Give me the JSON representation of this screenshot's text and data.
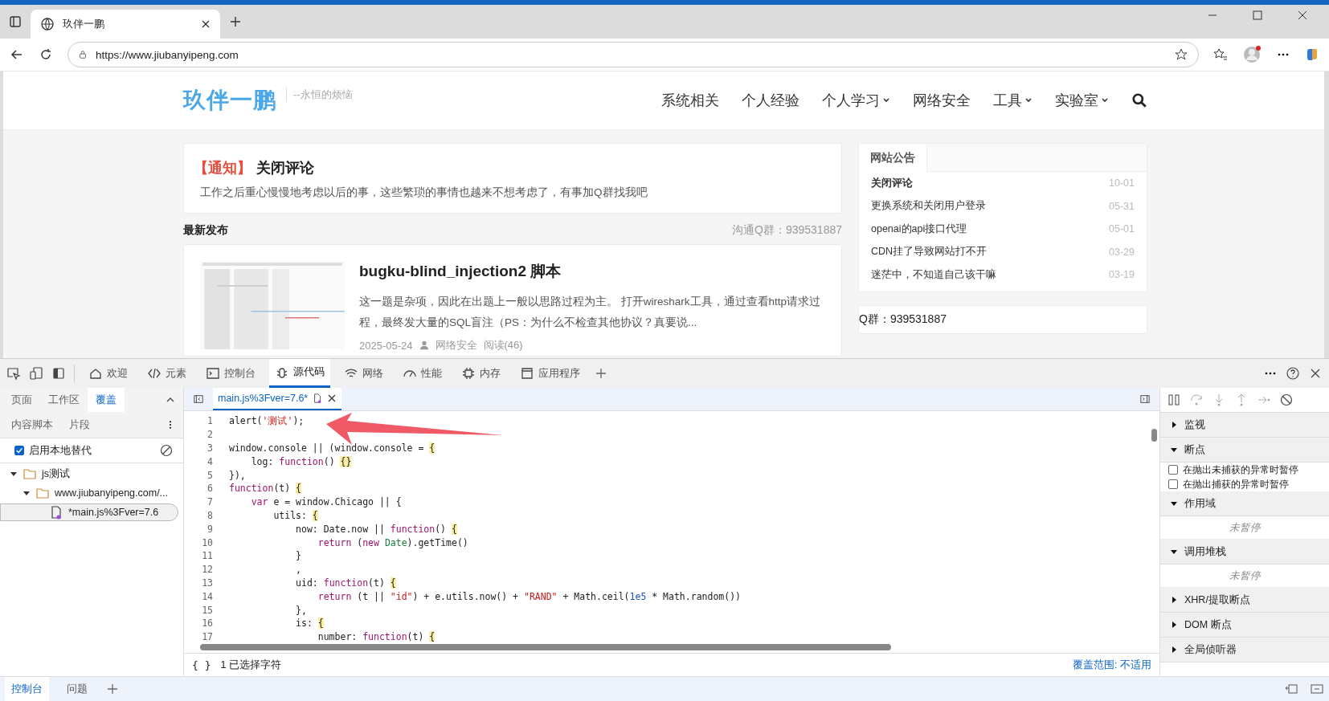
{
  "browser": {
    "tab_title": "玖伴一鹏",
    "url": "https://www.jiubanyipeng.com"
  },
  "site": {
    "logo": "玖伴一鹏",
    "tagline": "--永恒的烦恼",
    "nav": [
      {
        "label": "系统相关",
        "dropdown": false
      },
      {
        "label": "个人经验",
        "dropdown": false
      },
      {
        "label": "个人学习",
        "dropdown": true
      },
      {
        "label": "网络安全",
        "dropdown": false
      },
      {
        "label": "工具",
        "dropdown": true
      },
      {
        "label": "实验室",
        "dropdown": true
      }
    ],
    "notice": {
      "tag": "【通知】",
      "title": "关闭评论",
      "body": "工作之后重心慢慢地考虑以后的事，这些繁琐的事情也越来不想考虑了，有事加Q群找我吧"
    },
    "latest": {
      "heading": "最新发布",
      "group": "沟通Q群：939531887"
    },
    "post": {
      "title": "bugku-blind_injection2 脚本",
      "excerpt": "这一题是杂项，因此在出题上一般以思路过程为主。 打开wireshark工具，通过查看http请求过程，最终发大量的SQL盲注（PS：为什么不检查其他协议？真要说...",
      "date": "2025-05-24",
      "category": "网络安全",
      "reads": "阅读(46)"
    },
    "announcements": {
      "tab": "网站公告",
      "items": [
        {
          "title": "关闭评论",
          "date": "10-01",
          "emphasis": true
        },
        {
          "title": "更换系统和关闭用户登录",
          "date": "05-31",
          "emphasis": false
        },
        {
          "title": "openai的api接口代理",
          "date": "05-01",
          "emphasis": false
        },
        {
          "title": "CDN挂了导致网站打不开",
          "date": "03-29",
          "emphasis": false
        },
        {
          "title": "迷茫中，不知道自己该干嘛",
          "date": "03-19",
          "emphasis": false
        }
      ]
    },
    "qq_card": "Q群：939531887"
  },
  "devtools": {
    "tabs": [
      {
        "label": "欢迎",
        "selected": false
      },
      {
        "label": "元素",
        "selected": false
      },
      {
        "label": "控制台",
        "selected": false
      },
      {
        "label": "源代码",
        "selected": true
      },
      {
        "label": "网络",
        "selected": false
      },
      {
        "label": "性能",
        "selected": false
      },
      {
        "label": "内存",
        "selected": false
      },
      {
        "label": "应用程序",
        "selected": false
      }
    ],
    "nav_tabs": [
      {
        "label": "页面",
        "selected": false
      },
      {
        "label": "工作区",
        "selected": false
      },
      {
        "label": "覆盖",
        "selected": true
      }
    ],
    "nav_tabs_2": [
      {
        "label": "内容脚本"
      },
      {
        "label": "片段"
      }
    ],
    "local_overrides": {
      "label": "启用本地替代",
      "checked": true
    },
    "tree": [
      {
        "label": "js测试",
        "kind": "folder",
        "expanded": true,
        "selected": false,
        "children": [
          {
            "label": "www.jiubanyipeng.com/...",
            "kind": "folder",
            "expanded": true,
            "selected": false,
            "children": [
              {
                "label": "*main.js%3Fver=7.6",
                "kind": "file",
                "selected": true
              }
            ]
          }
        ]
      }
    ],
    "file_tab": "main.js%3Fver=7.6*",
    "code": [
      {
        "n": "1",
        "tokens": [
          {
            "t": "alert(",
            "kind": "plain"
          },
          {
            "t": "'测试'",
            "kind": "string"
          },
          {
            "t": ");",
            "kind": "plain"
          }
        ]
      },
      {
        "n": "2"
      },
      {
        "n": "3",
        "tokens": [
          {
            "t": "window.console || (window.console = ",
            "kind": "plain"
          },
          {
            "t": "{",
            "kind": "brace"
          }
        ]
      },
      {
        "n": "4",
        "tokens": [
          {
            "t": "    log: ",
            "kind": "plain"
          },
          {
            "t": "function",
            "kind": "keyword"
          },
          {
            "t": "() ",
            "kind": "plain"
          },
          {
            "t": "{}",
            "kind": "brace"
          }
        ]
      },
      {
        "n": "5",
        "tokens": [
          {
            "t": "}),",
            "kind": "plain"
          }
        ]
      },
      {
        "n": "6",
        "tokens": [
          {
            "t": "function",
            "kind": "keyword"
          },
          {
            "t": "(t) ",
            "kind": "plain"
          },
          {
            "t": "{",
            "kind": "brace"
          }
        ]
      },
      {
        "n": "7",
        "tokens": [
          {
            "t": "    var",
            "kind": "keyword"
          },
          {
            "t": " e = window.Chicago || {",
            "kind": "plain"
          }
        ]
      },
      {
        "n": "8",
        "tokens": [
          {
            "t": "        utils: ",
            "kind": "plain"
          },
          {
            "t": "{",
            "kind": "brace"
          }
        ]
      },
      {
        "n": "9",
        "tokens": [
          {
            "t": "            now: Date.now || ",
            "kind": "plain"
          },
          {
            "t": "function",
            "kind": "keyword"
          },
          {
            "t": "() ",
            "kind": "plain"
          },
          {
            "t": "{",
            "kind": "brace"
          }
        ]
      },
      {
        "n": "10",
        "tokens": [
          {
            "t": "                return",
            "kind": "keyword"
          },
          {
            "t": " (",
            "kind": "plain"
          },
          {
            "t": "new",
            "kind": "keyword"
          },
          {
            "t": " Date",
            "kind": "class"
          },
          {
            "t": ").getTime()",
            "kind": "plain"
          }
        ]
      },
      {
        "n": "11",
        "tokens": [
          {
            "t": "            }",
            "kind": "plain"
          }
        ]
      },
      {
        "n": "12",
        "tokens": [
          {
            "t": "            ,",
            "kind": "plain"
          }
        ]
      },
      {
        "n": "13",
        "tokens": [
          {
            "t": "            uid: ",
            "kind": "plain"
          },
          {
            "t": "function",
            "kind": "keyword"
          },
          {
            "t": "(t) ",
            "kind": "plain"
          },
          {
            "t": "{",
            "kind": "brace"
          }
        ]
      },
      {
        "n": "14",
        "tokens": [
          {
            "t": "                return",
            "kind": "keyword"
          },
          {
            "t": " (t || ",
            "kind": "plain"
          },
          {
            "t": "\"id\"",
            "kind": "string"
          },
          {
            "t": ") + e.utils.now() + ",
            "kind": "plain"
          },
          {
            "t": "\"RAND\"",
            "kind": "string"
          },
          {
            "t": " + Math.ceil(",
            "kind": "plain"
          },
          {
            "t": "1e5",
            "kind": "number"
          },
          {
            "t": " * Math.random())",
            "kind": "plain"
          }
        ]
      },
      {
        "n": "15",
        "tokens": [
          {
            "t": "            },",
            "kind": "plain"
          }
        ]
      },
      {
        "n": "16",
        "tokens": [
          {
            "t": "            is: ",
            "kind": "plain"
          },
          {
            "t": "{",
            "kind": "brace"
          }
        ]
      },
      {
        "n": "17",
        "tokens": [
          {
            "t": "                number: ",
            "kind": "plain"
          },
          {
            "t": "function",
            "kind": "keyword"
          },
          {
            "t": "(t) ",
            "kind": "plain"
          },
          {
            "t": "{",
            "kind": "brace"
          }
        ]
      }
    ],
    "status": {
      "selection": "1 已选择字符",
      "coverage": "覆盖范围: 不适用",
      "braces": "{ }"
    },
    "sections": [
      {
        "title": "监视",
        "expanded": false
      },
      {
        "title": "断点",
        "expanded": true,
        "options": [
          {
            "label": "在抛出未捕获的异常时暂停",
            "checked": false
          },
          {
            "label": "在抛出捕获的异常时暂停",
            "checked": false
          }
        ]
      },
      {
        "title": "作用域",
        "expanded": true,
        "message": "未暂停"
      },
      {
        "title": "调用堆栈",
        "expanded": true,
        "message": "未暂停"
      },
      {
        "title": "XHR/提取断点",
        "expanded": false
      },
      {
        "title": "DOM 断点",
        "expanded": false
      },
      {
        "title": "全局侦听器",
        "expanded": false
      }
    ],
    "drawer_tabs": [
      {
        "label": "控制台",
        "selected": true
      },
      {
        "label": "问题",
        "selected": false
      }
    ]
  }
}
